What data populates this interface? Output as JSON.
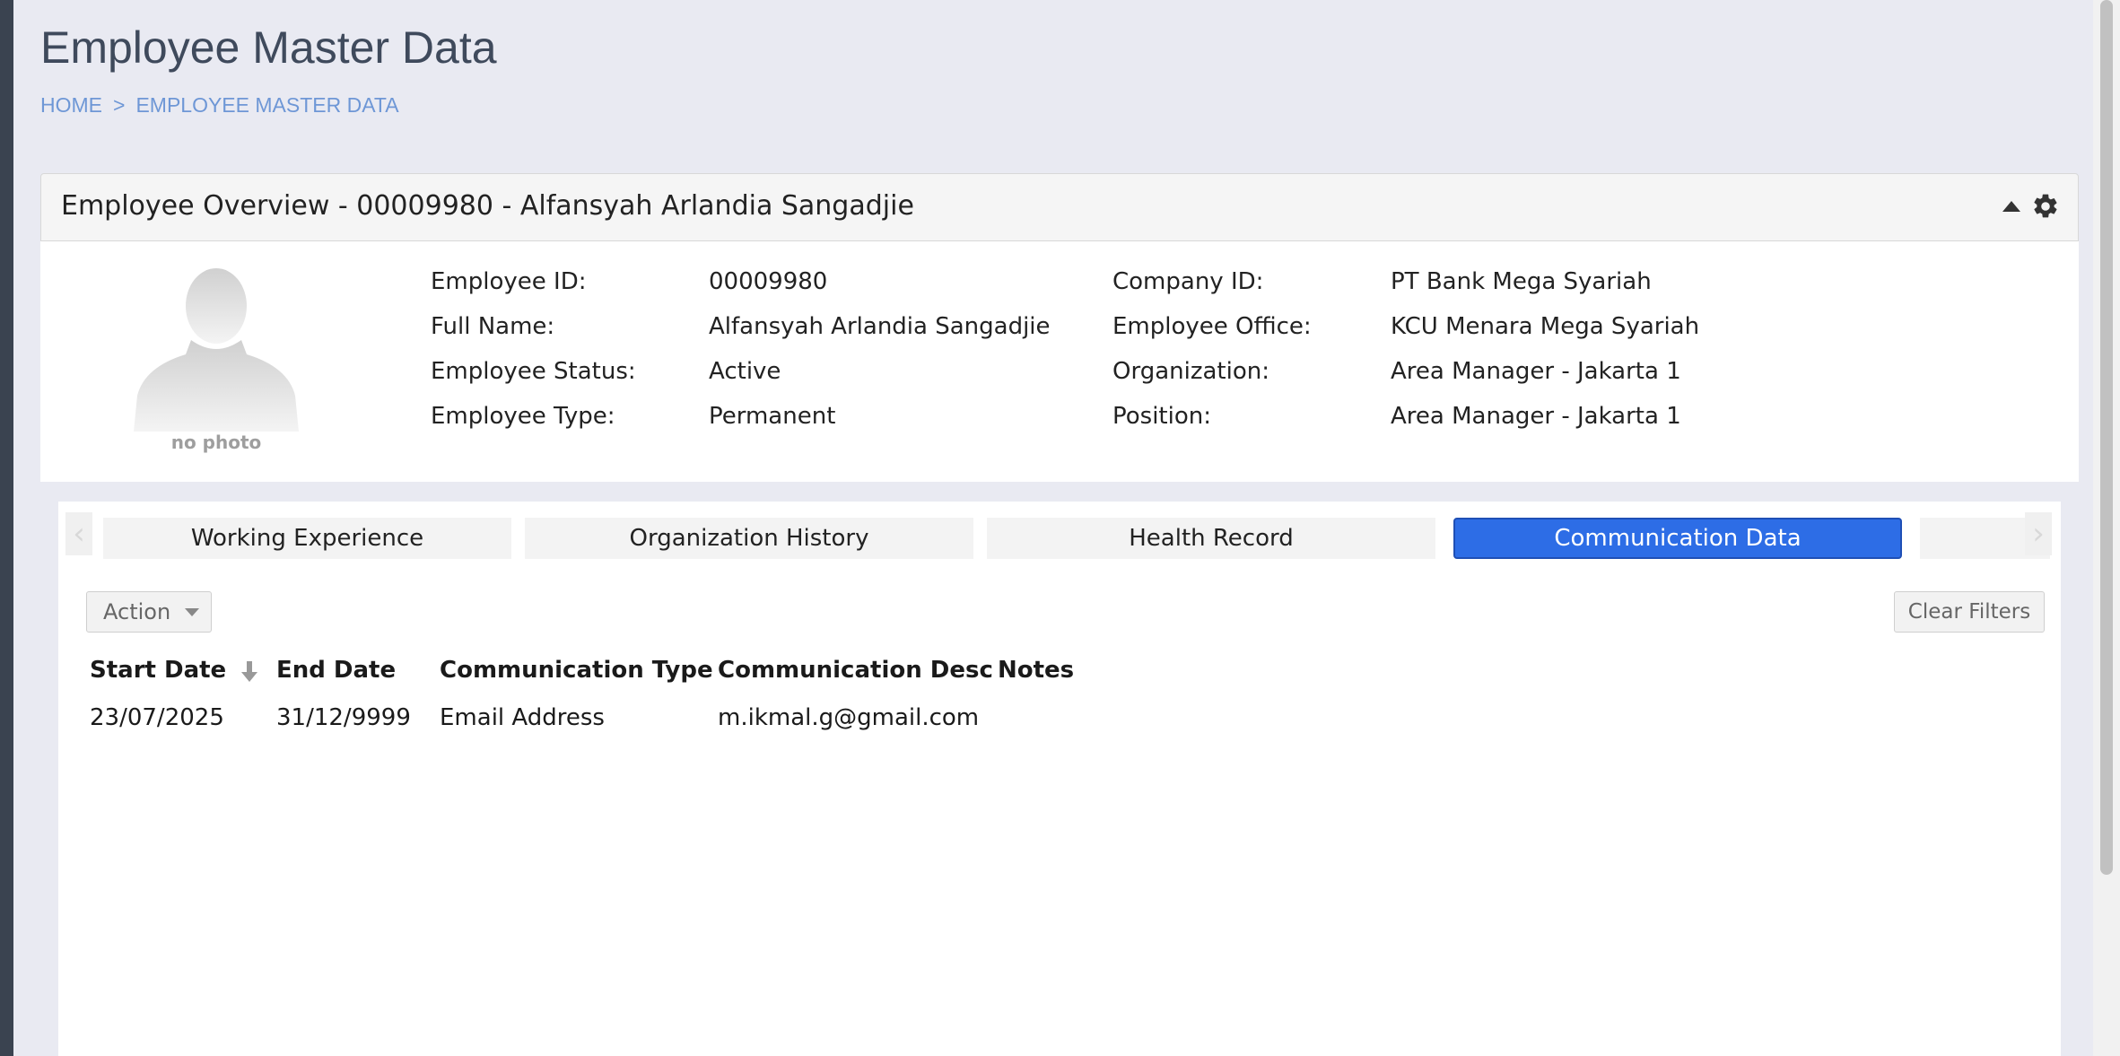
{
  "page": {
    "title": "Employee Master Data",
    "breadcrumb": [
      "HOME",
      ">",
      "EMPLOYEE MASTER DATA"
    ]
  },
  "overview": {
    "title": "Employee Overview - 00009980 - Alfansyah Arlandia Sangadjie",
    "photo_placeholder": "no photo",
    "fields": [
      {
        "label": "Employee ID:",
        "value": "00009980"
      },
      {
        "label": "Full Name:",
        "value": "Alfansyah Arlandia Sangadjie"
      },
      {
        "label": "Employee Status:",
        "value": "Active"
      },
      {
        "label": "Employee Type:",
        "value": "Permanent"
      },
      {
        "label": "Company ID:",
        "value": "PT Bank Mega Syariah"
      },
      {
        "label": "Employee Office:",
        "value": "KCU Menara Mega Syariah"
      },
      {
        "label": "Organization:",
        "value": "Area Manager - Jakarta 1"
      },
      {
        "label": "Position:",
        "value": "Area Manager - Jakarta 1"
      }
    ],
    "icons": {
      "collapse": "caret-up-icon",
      "settings": "gear-icon"
    }
  },
  "tabs": [
    {
      "label": "Working Experience",
      "active": false
    },
    {
      "label": "Organization History",
      "active": false
    },
    {
      "label": "Health Record",
      "active": false
    },
    {
      "label": "Communication Data",
      "active": true
    },
    {
      "label": "",
      "active": false
    }
  ],
  "toolbar": {
    "action_label": "Action",
    "clear_filters_label": "Clear Filters"
  },
  "grid": {
    "columns": [
      "Start Date",
      "End Date",
      "Communication Type",
      "Communication Desc",
      "Notes"
    ],
    "sorted_column": "Start Date",
    "rows": [
      [
        "23/07/2025",
        "31/12/9999",
        "Email Address",
        "m.ikmal.g@gmail.com",
        ""
      ]
    ]
  },
  "colors": {
    "accent": "#2d6de6",
    "breadcrumb": "#6e97d6",
    "background": "#e9eaf2"
  }
}
